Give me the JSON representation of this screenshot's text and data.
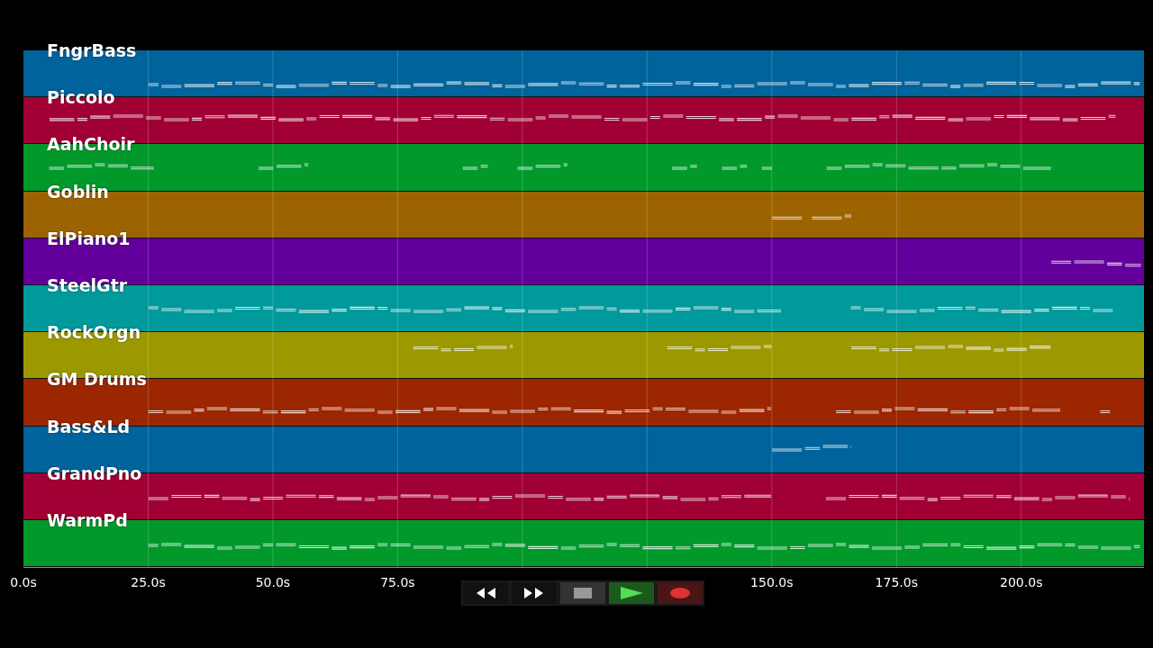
{
  "tracks": [
    {
      "name": "FngrBass",
      "color": "#00639c"
    },
    {
      "name": "Piccolo",
      "color": "#a10035"
    },
    {
      "name": "AahChoir",
      "color": "#00992a"
    },
    {
      "name": "Goblin",
      "color": "#9c6300"
    },
    {
      "name": "ElPiano1",
      "color": "#63009c"
    },
    {
      "name": "SteelGtr",
      "color": "#00999c"
    },
    {
      "name": "RockOrgn",
      "color": "#9c9900"
    },
    {
      "name": "GM Drums",
      "color": "#9c2600"
    },
    {
      "name": "Bass&Ld",
      "color": "#00639c"
    },
    {
      "name": "GrandPno",
      "color": "#a10035"
    },
    {
      "name": "WarmPd",
      "color": "#00992a"
    }
  ],
  "time_axis": {
    "ticks": [
      "0.0s",
      "25.0s",
      "50.0s",
      "75.0s",
      "150.0s",
      "175.0s",
      "200.0s"
    ]
  },
  "transport": [
    {
      "kind": "rewind"
    },
    {
      "kind": "forward"
    },
    {
      "kind": "stop"
    },
    {
      "kind": "play"
    },
    {
      "kind": "record"
    }
  ]
}
